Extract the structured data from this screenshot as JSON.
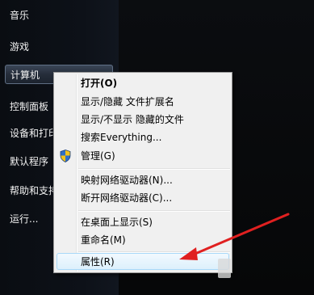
{
  "start_menu": {
    "items": [
      {
        "label": "音乐"
      },
      {
        "label": "游戏"
      },
      {
        "label": "计算机"
      },
      {
        "label": "控制面板"
      },
      {
        "label": "设备和打印"
      },
      {
        "label": "默认程序"
      },
      {
        "label": "帮助和支持"
      },
      {
        "label": "运行..."
      }
    ]
  },
  "context_menu": {
    "items": [
      {
        "label": "打开(O)"
      },
      {
        "label": "显示/隐藏 文件扩展名"
      },
      {
        "label": "显示/不显示 隐藏的文件"
      },
      {
        "label": "搜索Everything..."
      },
      {
        "label": "管理(G)"
      },
      {
        "label": "映射网络驱动器(N)..."
      },
      {
        "label": "断开网络驱动器(C)..."
      },
      {
        "label": "在桌面上显示(S)"
      },
      {
        "label": "重命名(M)"
      },
      {
        "label": "属性(R)"
      }
    ]
  },
  "colors": {
    "arrow": "#e02020",
    "menu_background": "#f0f0f0",
    "hover_border": "#a8d8f8"
  },
  "icons": {
    "shield": "uac-shield-icon"
  }
}
